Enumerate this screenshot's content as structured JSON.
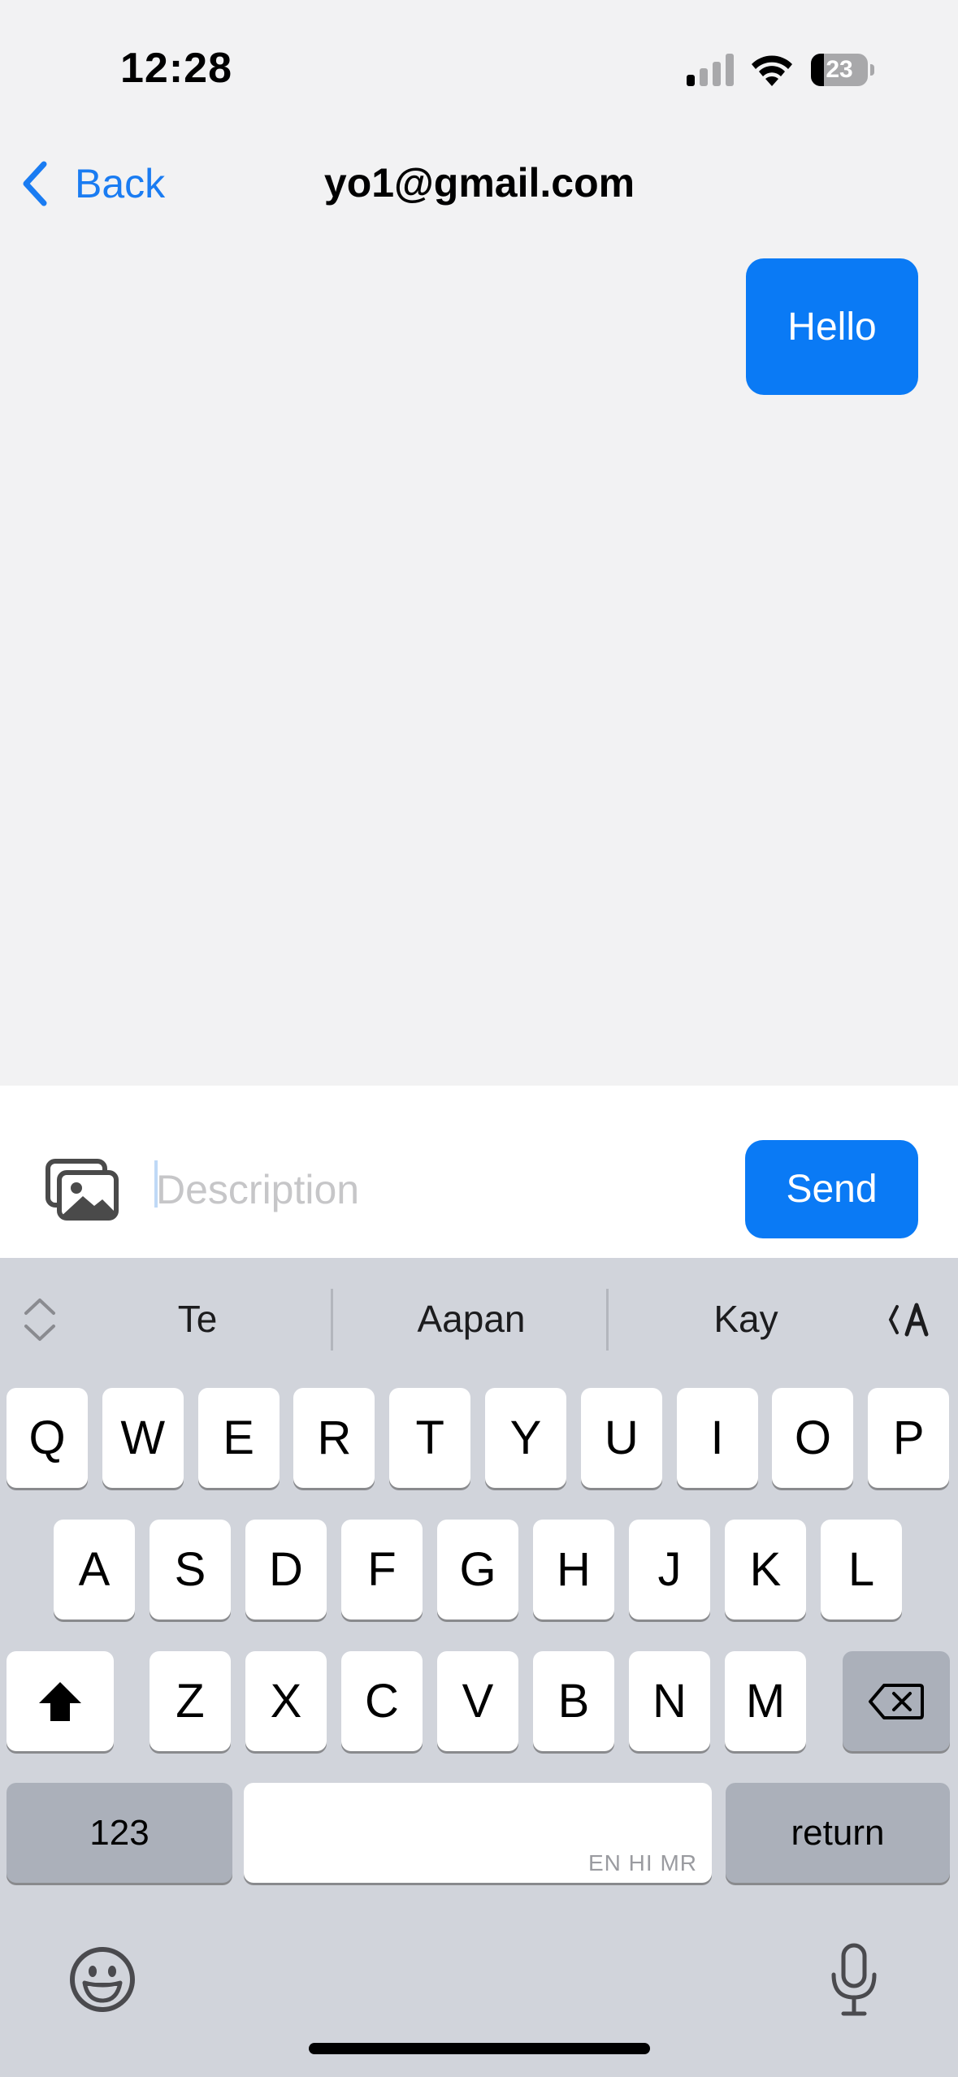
{
  "status_bar": {
    "time": "12:28",
    "battery_percent": "23",
    "battery_level": 0.23,
    "signal_bars_active": 1
  },
  "nav": {
    "back_label": "Back",
    "title": "yo1@gmail.com"
  },
  "messages": [
    {
      "text": "Hello",
      "direction": "outgoing",
      "color": "#0a7af5"
    }
  ],
  "composer": {
    "placeholder": "Description",
    "value": "",
    "send_label": "Send",
    "accent": "#0a7af5"
  },
  "keyboard": {
    "suggestions": [
      "Te",
      "Aapan",
      "Kay"
    ],
    "row1": [
      "Q",
      "W",
      "E",
      "R",
      "T",
      "Y",
      "U",
      "I",
      "O",
      "P"
    ],
    "row2": [
      "A",
      "S",
      "D",
      "F",
      "G",
      "H",
      "J",
      "K",
      "L"
    ],
    "row3": [
      "Z",
      "X",
      "C",
      "V",
      "B",
      "N",
      "M"
    ],
    "numbers_label": "123",
    "return_label": "return",
    "space_languages": "EN HI MR",
    "icons": {
      "shift": "shift-icon",
      "delete": "delete-icon",
      "emoji": "emoji-icon",
      "mic": "mic-icon",
      "suggestions_toggle": "chevron-updown-icon",
      "translate": "translate-icon"
    }
  }
}
